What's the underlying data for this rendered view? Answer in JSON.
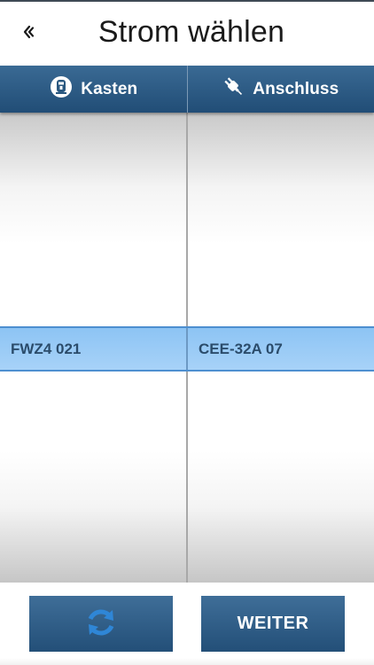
{
  "header": {
    "title": "Strom wählen",
    "back_icon": "double-chevron-left-icon"
  },
  "columns": [
    {
      "label": "Kasten",
      "icon": "meter-box-icon"
    },
    {
      "label": "Anschluss",
      "icon": "plug-icon"
    }
  ],
  "selection": {
    "kasten": "FWZ4 021",
    "anschluss": "CEE-32A 07"
  },
  "footer": {
    "refresh_icon": "refresh-icon",
    "next_label": "WEITER"
  },
  "colors": {
    "header_blue": "#2a5880",
    "selection_blue": "#9ccbf6",
    "selection_text": "#2b4c6b",
    "refresh_icon_color": "#2f86d6"
  }
}
